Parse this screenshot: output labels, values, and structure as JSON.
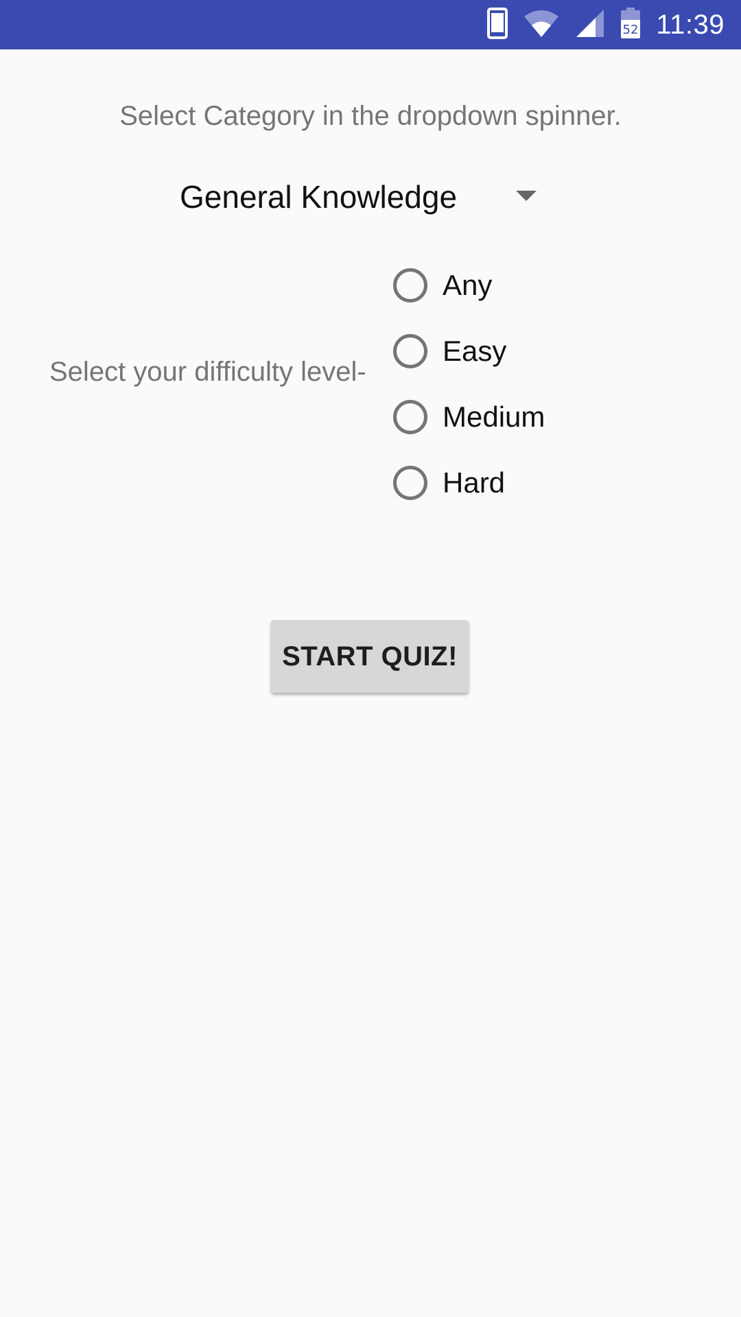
{
  "status_bar": {
    "time": "11:39",
    "battery_level": "52",
    "icons": [
      "phone-icon",
      "wifi-icon",
      "cell-signal-icon",
      "battery-icon"
    ],
    "background_color": "#3a4ab0"
  },
  "main": {
    "instruction_text": "Select Category in the dropdown spinner.",
    "category_spinner": {
      "selected_value": "General Knowledge"
    },
    "difficulty": {
      "label": "Select your difficulty level-",
      "options": [
        {
          "label": "Any",
          "selected": false
        },
        {
          "label": "Easy",
          "selected": false
        },
        {
          "label": "Medium",
          "selected": false
        },
        {
          "label": "Hard",
          "selected": false
        }
      ]
    },
    "start_button_label": "START QUIZ!"
  }
}
